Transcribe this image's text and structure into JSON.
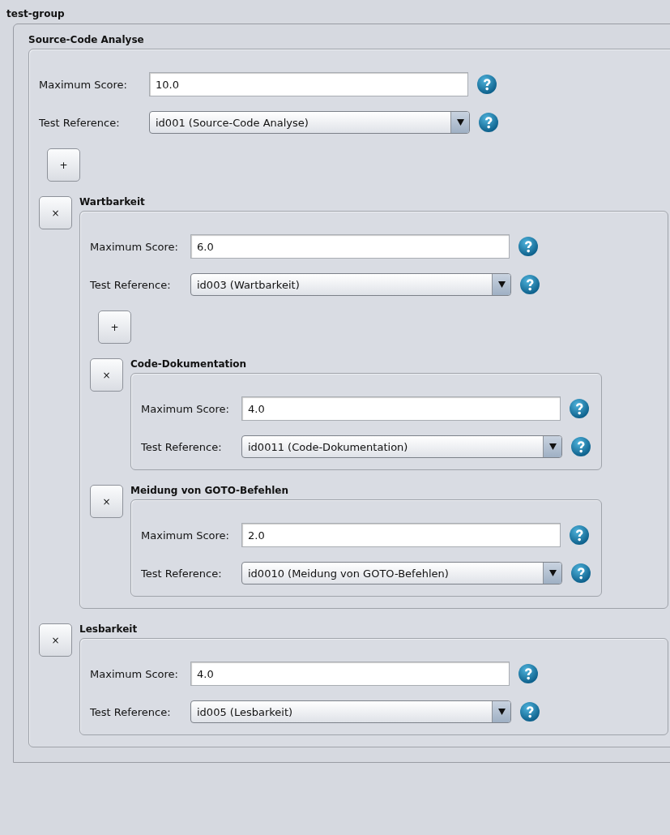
{
  "title": "test-group",
  "group": {
    "title": "Source-Code Analyse",
    "max_score_label": "Maximum Score:",
    "max_score": "10.0",
    "test_reference_label": "Test Reference:",
    "test_reference": "id001 (Source-Code Analyse)",
    "add_button": "+",
    "children": [
      {
        "remove_button": "×",
        "title": "Wartbarkeit",
        "max_score_label": "Maximum Score:",
        "max_score": "6.0",
        "test_reference_label": "Test Reference:",
        "test_reference": "id003 (Wartbarkeit)",
        "add_button": "+",
        "children": [
          {
            "remove_button": "×",
            "title": "Code-Dokumentation",
            "max_score_label": "Maximum Score:",
            "max_score": "4.0",
            "test_reference_label": "Test Reference:",
            "test_reference": "id0011 (Code-Dokumentation)"
          },
          {
            "remove_button": "×",
            "title": "Meidung von GOTO-Befehlen",
            "max_score_label": "Maximum Score:",
            "max_score": "2.0",
            "test_reference_label": "Test Reference:",
            "test_reference": "id0010 (Meidung von GOTO-Befehlen)"
          }
        ]
      },
      {
        "remove_button": "×",
        "title": "Lesbarkeit",
        "max_score_label": "Maximum Score:",
        "max_score": "4.0",
        "test_reference_label": "Test Reference:",
        "test_reference": "id005 (Lesbarkeit)"
      }
    ]
  }
}
